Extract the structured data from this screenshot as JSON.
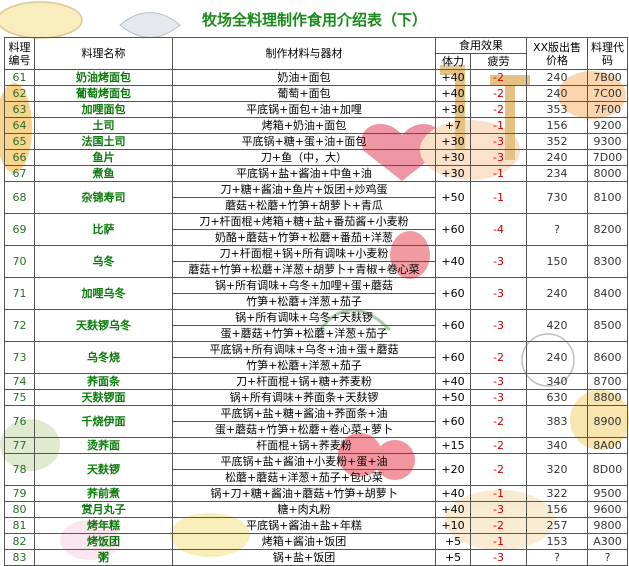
{
  "title": "牧场全料理制作食用介绍表（下）",
  "header": {
    "no": "料理编号",
    "name": "料理名称",
    "materials": "制作材料与器材",
    "effect": "食用效果",
    "hp": "体力",
    "fatigue": "疲劳",
    "price": "XX版出售价格",
    "code": "料理代码"
  },
  "rows": [
    {
      "no": "61",
      "name": "奶油烤面包",
      "mat": [
        "奶油+面包"
      ],
      "hp": "+40",
      "ft": "-2",
      "price": "240",
      "code": "7B00"
    },
    {
      "no": "62",
      "name": "葡萄烤面包",
      "mat": [
        "葡萄+面包"
      ],
      "hp": "+40",
      "ft": "-2",
      "price": "240",
      "code": "7C00"
    },
    {
      "no": "63",
      "name": "加哩面包",
      "mat": [
        "平底锅+面包+油+加哩"
      ],
      "hp": "+30",
      "ft": "-2",
      "price": "353",
      "code": "7F00"
    },
    {
      "no": "64",
      "name": "土司",
      "mat": [
        "烤箱+奶油+面包"
      ],
      "hp": "+7",
      "ft": "-1",
      "price": "156",
      "code": "9200"
    },
    {
      "no": "65",
      "name": "法国土司",
      "mat": [
        "平底锅+糖+蛋+油+面包"
      ],
      "hp": "+30",
      "ft": "-3",
      "price": "352",
      "code": "9300"
    },
    {
      "no": "66",
      "name": "鱼片",
      "mat": [
        "刀+鱼（中，大）"
      ],
      "hp": "+30",
      "ft": "-3",
      "price": "240",
      "code": "7D00"
    },
    {
      "no": "67",
      "name": "煮鱼",
      "mat": [
        "平底锅+盐+酱油+中鱼+油"
      ],
      "hp": "+30",
      "ft": "-1",
      "price": "234",
      "code": "8000"
    },
    {
      "no": "68",
      "name": "杂锦寿司",
      "mat": [
        "刀+糖+酱油+鱼片+饭团+炒鸡蛋",
        "蘑菇+松蘑+竹笋+胡萝卜+青瓜"
      ],
      "hp": "+50",
      "ft": "-1",
      "price": "730",
      "code": "8100"
    },
    {
      "no": "69",
      "name": "比萨",
      "mat": [
        "刀+杆面棍+烤箱+糖+盐+番茄酱+小麦粉",
        "奶酪+蘑菇+竹笋+松蘑+番茄+洋葱"
      ],
      "hp": "+60",
      "ft": "-4",
      "price": "?",
      "code": "8200"
    },
    {
      "no": "70",
      "name": "乌冬",
      "mat": [
        "刀+杆面棍+锅+所有调味+小麦粉",
        "蘑菇+竹笋+松蘑+洋葱+胡萝卜+青椒+卷心菜"
      ],
      "hp": "+40",
      "ft": "-3",
      "price": "150",
      "code": "8300"
    },
    {
      "no": "71",
      "name": "加哩乌冬",
      "mat": [
        "锅+所有调味+乌冬+加哩+蛋+蘑菇",
        "竹笋+松蘑+洋葱+茄子"
      ],
      "hp": "+60",
      "ft": "-3",
      "price": "240",
      "code": "8400"
    },
    {
      "no": "72",
      "name": "天麸锣乌冬",
      "mat": [
        "锅+所有调味+乌冬+天麸锣",
        "蛋+蘑菇+竹笋+松蘑+洋葱+茄子"
      ],
      "hp": "+60",
      "ft": "-3",
      "price": "420",
      "code": "8500"
    },
    {
      "no": "73",
      "name": "乌冬烧",
      "mat": [
        "平底锅+所有调味+乌冬+油+蛋+蘑菇",
        "竹笋+松蘑+洋葱+茄子"
      ],
      "hp": "+60",
      "ft": "-2",
      "price": "240",
      "code": "8600"
    },
    {
      "no": "74",
      "name": "荞面条",
      "mat": [
        "刀+杆面棍+锅+糖+荞麦粉"
      ],
      "hp": "+40",
      "ft": "-3",
      "price": "340",
      "code": "8700"
    },
    {
      "no": "75",
      "name": "天麸锣面",
      "mat": [
        "锅+所有调味+荞面条+天麸锣"
      ],
      "hp": "+50",
      "ft": "-3",
      "price": "630",
      "code": "8800"
    },
    {
      "no": "76",
      "name": "千烧伊面",
      "mat": [
        "平底锅+盐+糖+酱油+荞面条+油",
        "蛋+蘑菇+竹笋+松蘑+卷心菜+萝卜"
      ],
      "hp": "+60",
      "ft": "-2",
      "price": "383",
      "code": "8900"
    },
    {
      "no": "77",
      "name": "烫荞面",
      "mat": [
        "杆面棍+锅+荞麦粉"
      ],
      "hp": "+15",
      "ft": "-2",
      "price": "340",
      "code": "8A00"
    },
    {
      "no": "78",
      "name": "天麸锣",
      "mat": [
        "平底锅+盐+酱油+小麦粉+蛋+油",
        "松蘑+蘑菇+洋葱+茄子+包心菜"
      ],
      "hp": "+20",
      "ft": "-2",
      "price": "320",
      "code": "8D00"
    },
    {
      "no": "79",
      "name": "荞前煮",
      "mat": [
        "锅+刀+糖+酱油+蘑菇+竹笋+胡萝卜"
      ],
      "hp": "+40",
      "ft": "-1",
      "price": "322",
      "code": "9500"
    },
    {
      "no": "80",
      "name": "赏月丸子",
      "mat": [
        "糖+肉丸粉"
      ],
      "hp": "+40",
      "ft": "-3",
      "price": "156",
      "code": "9600"
    },
    {
      "no": "81",
      "name": "烤年糕",
      "mat": [
        "平底锅+酱油+盐+年糕"
      ],
      "hp": "+10",
      "ft": "-2",
      "price": "257",
      "code": "9800"
    },
    {
      "no": "82",
      "name": "烤饭团",
      "mat": [
        "烤箱+酱油+饭团"
      ],
      "hp": "+5",
      "ft": "-1",
      "price": "153",
      "code": "A300"
    },
    {
      "no": "83",
      "name": "粥",
      "mat": [
        "锅+盐+饭团"
      ],
      "hp": "+5",
      "ft": "-3",
      "price": "?",
      "code": "?"
    }
  ],
  "colors": {
    "title": "#1a8a1a",
    "name": "#0a7a0a",
    "fatigue": "#cc0000",
    "border": "#555555"
  }
}
